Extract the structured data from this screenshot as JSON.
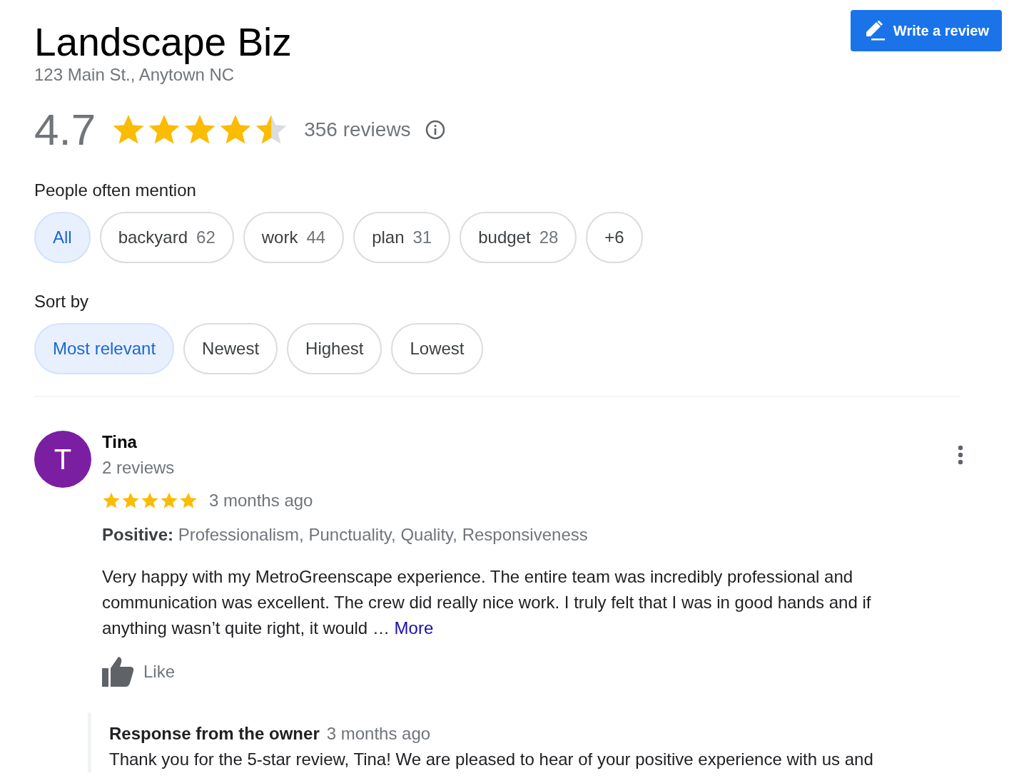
{
  "business": {
    "name": "Landscape Biz",
    "address": "123 Main St., Anytown NC"
  },
  "write_review_button": "Write a review",
  "summary": {
    "rating": "4.7",
    "stars": 4.5,
    "reviews": "356 reviews"
  },
  "mentions": {
    "label": "People often mention",
    "chips": [
      {
        "label": "All",
        "selected": true
      },
      {
        "label": "backyard",
        "count": "62",
        "selected": false
      },
      {
        "label": "work",
        "count": "44",
        "selected": false
      },
      {
        "label": "plan",
        "count": "31",
        "selected": false
      },
      {
        "label": "budget",
        "count": "28",
        "selected": false
      },
      {
        "label": "+6",
        "selected": false
      }
    ]
  },
  "sort": {
    "label": "Sort by",
    "options": [
      {
        "label": "Most relevant",
        "selected": true
      },
      {
        "label": "Newest",
        "selected": false
      },
      {
        "label": "Highest",
        "selected": false
      },
      {
        "label": "Lowest",
        "selected": false
      }
    ]
  },
  "reviews": [
    {
      "avatar_letter": "T",
      "author": "Tina",
      "author_reviews": "2 reviews",
      "stars": 5,
      "time": "3 months ago",
      "attributes": "**Positive:** Professionalism, Punctuality, Quality, Responsiveness",
      "text": "Very happy with my MetroGreenscape experience. The entire team was incredibly professional and communication was excellent. The crew did really nice work. I truly felt that I was in good hands and if anything wasn’t quite right, it would …",
      "more_link": "More",
      "like": "Like",
      "owner_response": {
        "title": "Response from the owner",
        "time": "3 months ago",
        "text": "Thank you for the 5-star review, Tina! We are pleased to hear of your positive experience with us and"
      }
    }
  ]
}
